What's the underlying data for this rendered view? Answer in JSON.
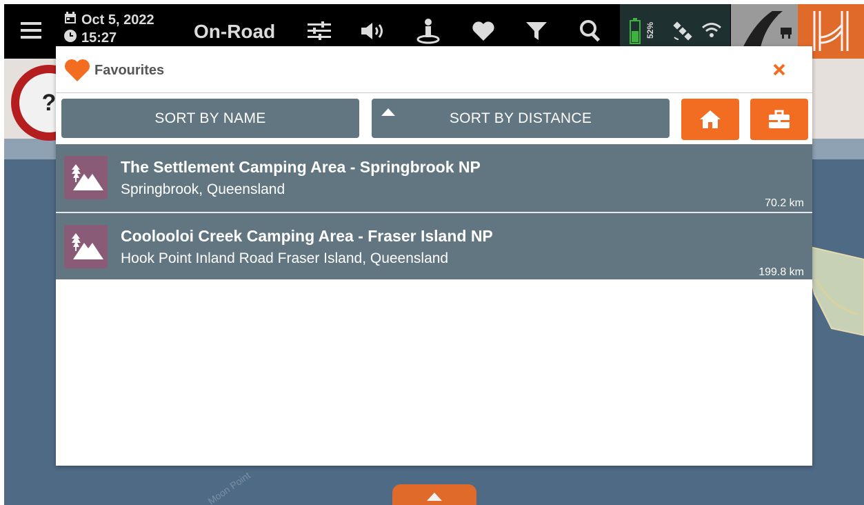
{
  "topbar": {
    "date": "Oct 5, 2022",
    "time": "15:27",
    "mode": "On-Road",
    "battery_percent": "52%",
    "icons": [
      "menu-icon",
      "calendar-icon",
      "clock-icon",
      "sliders-icon",
      "volume-icon",
      "person-pin-icon",
      "heart-icon",
      "filter-icon",
      "search-icon",
      "battery-icon",
      "satellite-icon",
      "wifi-icon",
      "road-icon",
      "brand-logo-icon"
    ]
  },
  "map": {
    "speed_sign": "?",
    "place_label": "Moon Point"
  },
  "dialog": {
    "title": "Favourites",
    "sort_by_name": "SORT BY NAME",
    "sort_by_distance": "SORT BY DISTANCE",
    "items": [
      {
        "name": "The Settlement Camping Area - Springbrook NP",
        "address": "Springbrook, Queensland",
        "distance": "70.2 km",
        "icon": "mountain-icon"
      },
      {
        "name": "Coolooloi Creek Camping Area - Fraser Island NP",
        "address": "Hook Point Inland Road Fraser Island, Queensland",
        "distance": "199.8 km",
        "icon": "mountain-icon"
      }
    ]
  },
  "colors": {
    "accent": "#f26d21",
    "row_bg": "#617680",
    "poi_bg": "#8a5b77",
    "topbar_bg": "#000000"
  }
}
